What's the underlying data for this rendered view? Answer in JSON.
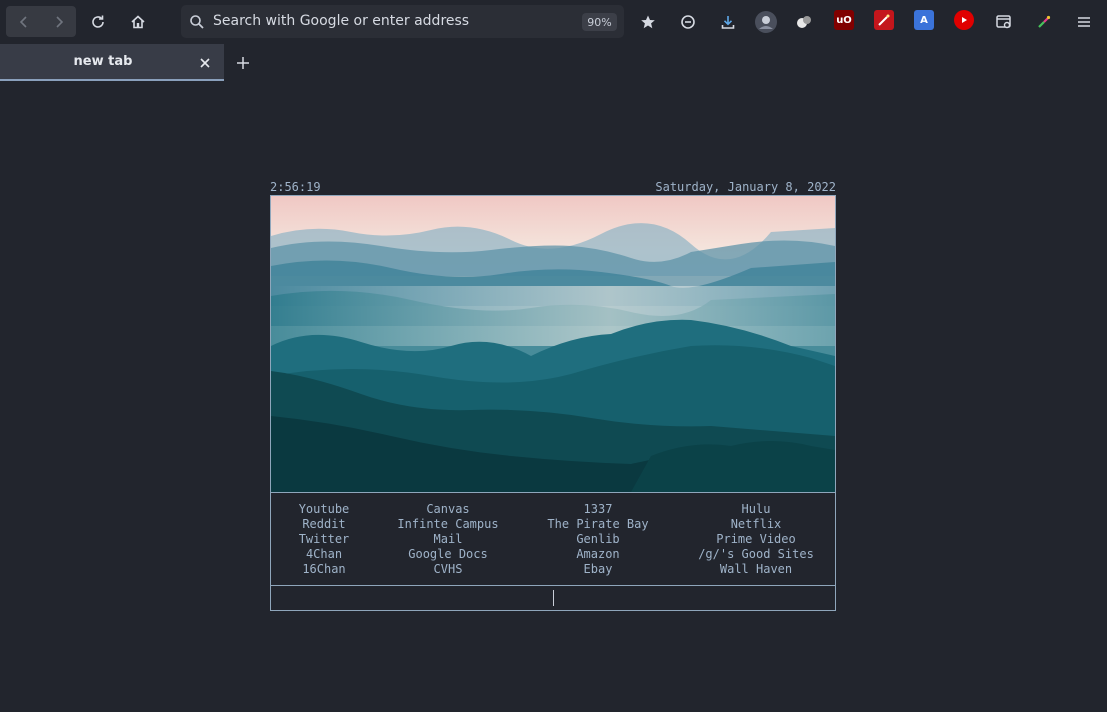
{
  "browser": {
    "urlbar": {
      "placeholder": "Search with Google or enter address",
      "zoom": "90%"
    },
    "tab": {
      "title": "new tab"
    },
    "extensions": [
      {
        "icon": "ublock-origin-icon",
        "label": "uO",
        "color": "#800000"
      },
      {
        "icon": "magic-wand-icon",
        "label": "",
        "color": "#c4161c"
      },
      {
        "icon": "translate-icon",
        "label": "A",
        "color": "#3b73d9"
      },
      {
        "icon": "youtube-icon",
        "label": "",
        "color": "#e00000"
      }
    ]
  },
  "start": {
    "time": "2:56:19",
    "date": "Saturday, January 8, 2022",
    "columns": [
      [
        "Youtube",
        "Reddit",
        "Twitter",
        "4Chan",
        "16Chan"
      ],
      [
        "Canvas",
        "Infinte Campus",
        "Mail",
        "Google Docs",
        "CVHS"
      ],
      [
        "1337",
        "The Pirate Bay",
        "Genlib",
        "Amazon",
        "Ebay"
      ],
      [
        "Hulu",
        "Netflix",
        "Prime Video",
        "/g/'s Good Sites",
        "Wall Haven"
      ]
    ]
  },
  "colors": {
    "background": "#22252d",
    "accent": "#9fb3c9",
    "border": "#8fa6bb"
  }
}
